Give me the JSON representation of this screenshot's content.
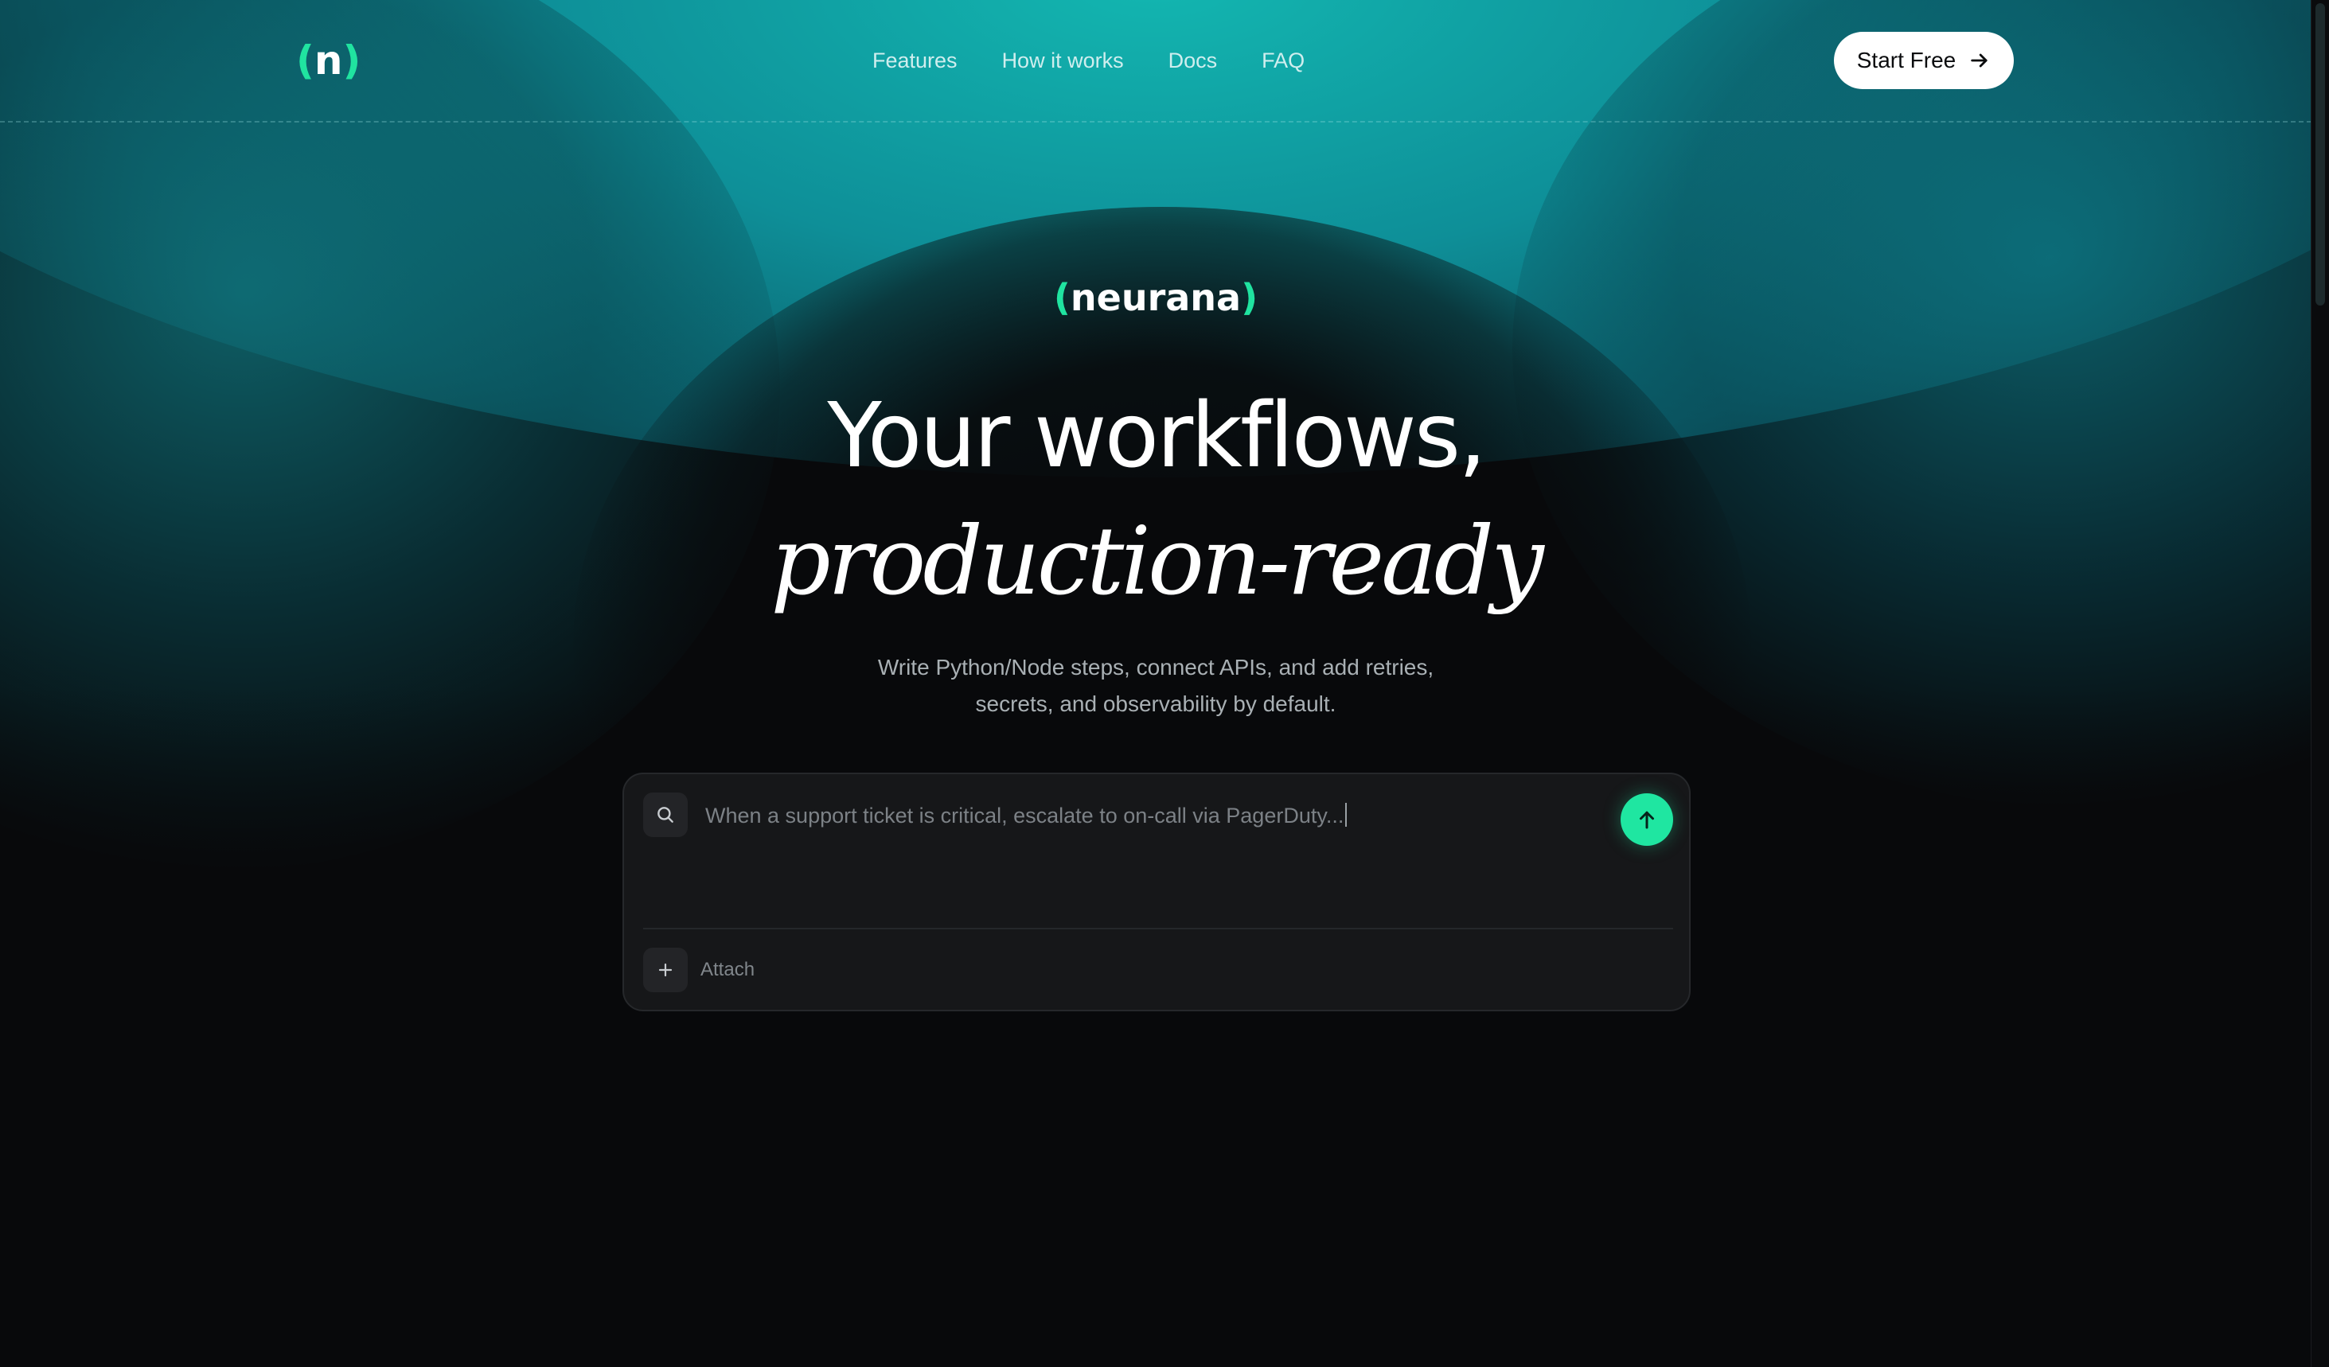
{
  "header": {
    "logo": {
      "open": "(",
      "letter": "n",
      "close": ")"
    },
    "nav": [
      "Features",
      "How it works",
      "Docs",
      "FAQ"
    ],
    "cta_label": "Start Free",
    "cta_icon": "arrow-right-icon"
  },
  "hero": {
    "brand": {
      "open": "(",
      "name": "neurana",
      "close": ")"
    },
    "headline": "Your workflows,",
    "headline_italic": "production-ready",
    "subtitle_line1": "Write Python/Node steps, connect APIs, and add retries,",
    "subtitle_line2": "secrets, and observability by default."
  },
  "prompt": {
    "search_icon": "search-icon",
    "text": "When a support ticket is critical, escalate to on-call via PagerDuty...",
    "send_icon": "arrow-up-icon",
    "attach_icon": "plus-icon",
    "attach_label": "Attach"
  },
  "colors": {
    "accent": "#1fe6a1",
    "background": "#08090b",
    "panel": "#161719",
    "teal_glow": "#13b7b1"
  }
}
